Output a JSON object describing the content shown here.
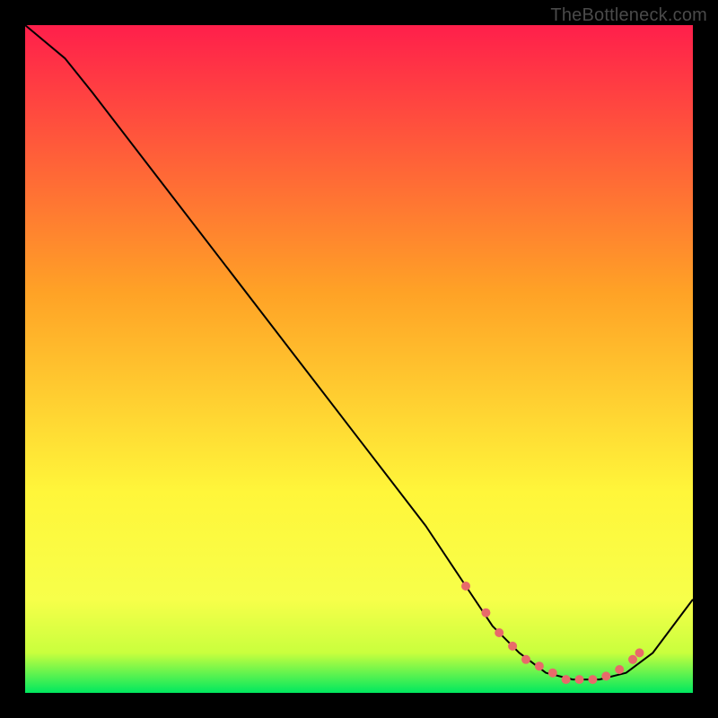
{
  "watermark": "TheBottleneck.com",
  "colors": {
    "frame_background": "#000000",
    "gradient_top": "#ff1f4b",
    "gradient_orange": "#ffa226",
    "gradient_yellow": "#fff63a",
    "gradient_yellow2": "#f7ff4a",
    "gradient_lime": "#c9ff3d",
    "gradient_green": "#00e85f",
    "curve_stroke": "#000000",
    "marker_fill": "#e86a6a"
  },
  "chart_data": {
    "type": "line",
    "title": "",
    "xlabel": "",
    "ylabel": "",
    "xlim": [
      0,
      100
    ],
    "ylim": [
      0,
      100
    ],
    "series": [
      {
        "name": "bottleneck-curve",
        "x": [
          0,
          6,
          10,
          20,
          30,
          40,
          50,
          60,
          66,
          70,
          74,
          78,
          82,
          86,
          90,
          94,
          100
        ],
        "y": [
          100,
          95,
          90,
          77,
          64,
          51,
          38,
          25,
          16,
          10,
          6,
          3,
          2,
          2,
          3,
          6,
          14
        ]
      }
    ],
    "markers": {
      "name": "trough-markers",
      "x": [
        66,
        69,
        71,
        73,
        75,
        77,
        79,
        81,
        83,
        85,
        87,
        89,
        91,
        92
      ],
      "y": [
        16,
        12,
        9,
        7,
        5,
        4,
        3,
        2,
        2,
        2,
        2.5,
        3.5,
        5,
        6
      ]
    },
    "gradient_stops": [
      {
        "offset": 0.0,
        "key": "gradient_top"
      },
      {
        "offset": 0.4,
        "key": "gradient_orange"
      },
      {
        "offset": 0.7,
        "key": "gradient_yellow"
      },
      {
        "offset": 0.86,
        "key": "gradient_yellow2"
      },
      {
        "offset": 0.94,
        "key": "gradient_lime"
      },
      {
        "offset": 1.0,
        "key": "gradient_green"
      }
    ]
  }
}
